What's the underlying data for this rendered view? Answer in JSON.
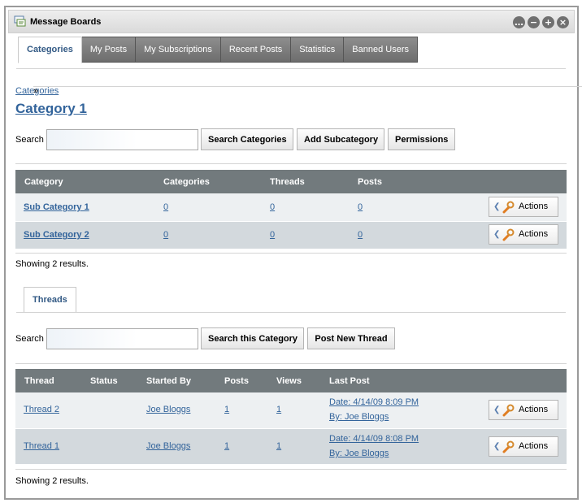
{
  "window": {
    "title": "Message Boards",
    "controls": [
      "…",
      "−",
      "+",
      "×"
    ]
  },
  "tabs": [
    {
      "label": "Categories",
      "active": true
    },
    {
      "label": "My Posts"
    },
    {
      "label": "My Subscriptions"
    },
    {
      "label": "Recent Posts"
    },
    {
      "label": "Statistics"
    },
    {
      "label": "Banned Users"
    }
  ],
  "breadcrumb": {
    "link": "Categories",
    "sep": "»"
  },
  "heading": "Category 1",
  "search1": {
    "label": "Search",
    "value": "",
    "buttons": [
      "Search Categories",
      "Add Subcategory",
      "Permissions"
    ]
  },
  "cat_table": {
    "headers": [
      "Category",
      "Categories",
      "Threads",
      "Posts"
    ],
    "rows": [
      {
        "name": "Sub Category 1",
        "categories": "0",
        "threads": "0",
        "posts": "0",
        "action": "Actions"
      },
      {
        "name": "Sub Category 2",
        "categories": "0",
        "threads": "0",
        "posts": "0",
        "action": "Actions"
      }
    ],
    "footer": "Showing 2 results."
  },
  "threads_tab": "Threads",
  "search2": {
    "label": "Search",
    "value": "",
    "buttons": [
      "Search this Category",
      "Post New Thread"
    ]
  },
  "thread_table": {
    "headers": [
      "Thread",
      "Status",
      "Started By",
      "Posts",
      "Views",
      "Last Post"
    ],
    "rows": [
      {
        "thread": "Thread 2",
        "status": "",
        "started_by": "Joe Bloggs",
        "posts": "1",
        "views": "1",
        "last_date": "Date: 4/14/09 8:09 PM",
        "last_by": "By: Joe Bloggs",
        "action": "Actions"
      },
      {
        "thread": "Thread 1",
        "status": "",
        "started_by": "Joe Bloggs",
        "posts": "1",
        "views": "1",
        "last_date": "Date: 4/14/09 8:08 PM",
        "last_by": "By: Joe Bloggs",
        "action": "Actions"
      }
    ],
    "footer": "Showing 2 results."
  },
  "icons": {
    "title": "message-boards-icon",
    "actions": "wrench-icon"
  }
}
